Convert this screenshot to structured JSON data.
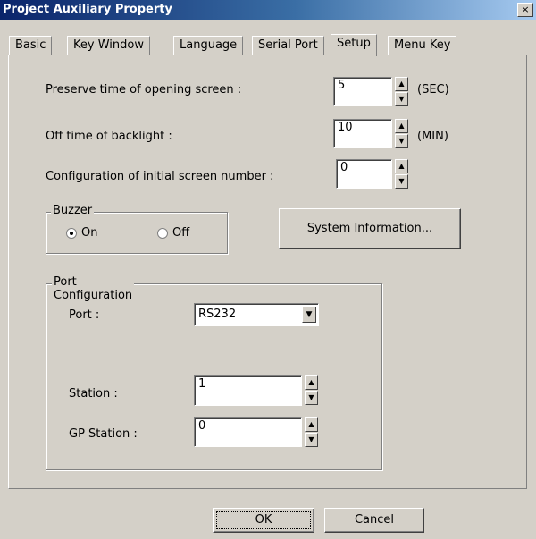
{
  "window": {
    "title": "Project Auxiliary Property",
    "close_label": "×"
  },
  "tabs": [
    {
      "label": "Basic"
    },
    {
      "label": "Key Window"
    },
    {
      "label": "Language"
    },
    {
      "label": "Serial Port"
    },
    {
      "label": "Setup",
      "active": true
    },
    {
      "label": "Menu Key"
    }
  ],
  "setup": {
    "preserve": {
      "label": "Preserve time of opening screen  :",
      "value": "5",
      "unit": "(SEC)"
    },
    "backlight": {
      "label": "Off time of backlight  :",
      "value": "10",
      "unit": "(MIN)"
    },
    "initial_screen": {
      "label": "Configuration of initial screen number  :",
      "value": "0"
    },
    "buzzer": {
      "title": "Buzzer",
      "on_label": "On",
      "off_label": "Off",
      "selected": "On"
    },
    "system_info_button": "System Information...",
    "port_config": {
      "title": "Port Configuration",
      "port_label": "Port :",
      "port_value": "RS232",
      "station_label": "Station :",
      "station_value": "1",
      "gp_station_label": "GP Station :",
      "gp_station_value": "0"
    }
  },
  "footer": {
    "ok_label": "OK",
    "cancel_label": "Cancel"
  },
  "icons": {
    "spin_up": "▲",
    "spin_down": "▼",
    "dropdown": "▼"
  }
}
